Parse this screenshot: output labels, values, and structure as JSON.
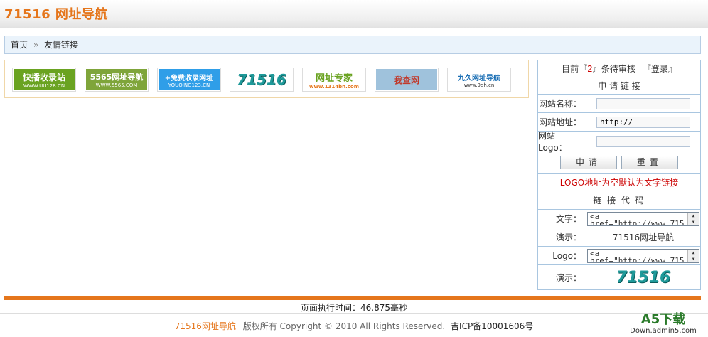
{
  "header": {
    "title": "71516 网址导航"
  },
  "breadcrumb": {
    "home": "首页",
    "sep": "»",
    "current": "友情链接"
  },
  "logos": [
    {
      "top": "快播收录站",
      "bottom": "WWW.UU128.CN",
      "bg": "#6aa321",
      "fg": "#ffffff"
    },
    {
      "top": "5565网址导航",
      "bottom": "WWW.5565.COM",
      "bg": "#7fa53a",
      "fg": "#ffffff"
    },
    {
      "top": "+免费收录网址",
      "bottom": "YOUQING123.CN",
      "bg": "#2f9ee8",
      "fg": "#ffffff"
    },
    {
      "top": "71516",
      "bottom": "",
      "bg": "#ffffff",
      "fg": "#1f9a9a"
    },
    {
      "top": "网址专家",
      "bottom": "www.1314bn.com",
      "bg": "#ffffff",
      "fg": "#6aa321"
    },
    {
      "top": "我查网",
      "bottom": "",
      "bg": "#9fc2dc",
      "fg": "#c0392b"
    },
    {
      "top": "九久网址导航",
      "bottom": "www.9dh.cn",
      "bg": "#ffffff",
      "fg": "#1b6fb5"
    }
  ],
  "panel": {
    "status_prefix": "目前『",
    "status_count": "2",
    "status_suffix": "』条待审核",
    "login": "『登录』",
    "apply_title": "申 请 链 接",
    "fields": [
      {
        "label": "网站名称：",
        "value": ""
      },
      {
        "label": "网站地址：",
        "value": "http://"
      },
      {
        "label": "网站Logo：",
        "value": ""
      }
    ],
    "submit": "申请",
    "reset": "重置",
    "note": "LOGO地址为空默认为文字链接",
    "code_title": "链 接 代 码",
    "text_label": "文字：",
    "text_code_line1": "<a",
    "text_code_line2": "href=\"http://www.715",
    "demo_label": "演示：",
    "demo_text": "71516网址导航",
    "logo_label": "Logo：",
    "logo_code_line1": "<a",
    "logo_code_line2": "href=\"http://www.715",
    "demo_logo_label": "演示：",
    "demo_logo": "71516"
  },
  "footer": {
    "exec": "页面执行时间：46.875毫秒",
    "brand": "71516网址导航",
    "rights": "版权所有  Copyright © 2010 All Rights Reserved.",
    "icp": "吉ICP备10001606号"
  },
  "watermark": {
    "big": "A5下载",
    "small": "Down.admin5.com"
  },
  "colors": {
    "accent": "#e5761c",
    "border": "#a9c6e0",
    "note": "#cc0000"
  }
}
